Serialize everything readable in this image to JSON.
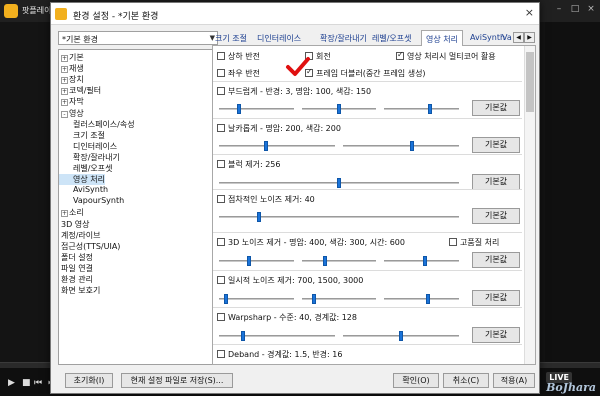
{
  "player": {
    "title": "팟플레이어 -",
    "live_label": "LIVE",
    "watermark": "BoJhara"
  },
  "dialog": {
    "title": "환경 설정 - *기본 환경",
    "close": "×"
  },
  "preset": {
    "value": "*기본 환경",
    "arrow": "▼"
  },
  "tree": [
    {
      "label": "기본",
      "exp": "+",
      "indent": 0
    },
    {
      "label": "재생",
      "exp": "+",
      "indent": 0
    },
    {
      "label": "장치",
      "exp": "+",
      "indent": 0
    },
    {
      "label": "코덱/필터",
      "exp": "+",
      "indent": 0
    },
    {
      "label": "자막",
      "exp": "+",
      "indent": 0
    },
    {
      "label": "영상",
      "exp": "-",
      "indent": 0
    },
    {
      "label": "컬러스페이스/속성",
      "exp": "",
      "indent": 1
    },
    {
      "label": "크기 조절",
      "exp": "",
      "indent": 1
    },
    {
      "label": "디인터레이스",
      "exp": "",
      "indent": 1
    },
    {
      "label": "확장/잘라내기",
      "exp": "",
      "indent": 1
    },
    {
      "label": "레벨/오프셋",
      "exp": "",
      "indent": 1
    },
    {
      "label": "영상 처리",
      "exp": "",
      "indent": 1,
      "selected": true
    },
    {
      "label": "AviSynth",
      "exp": "",
      "indent": 1
    },
    {
      "label": "VapourSynth",
      "exp": "",
      "indent": 1
    },
    {
      "label": "소리",
      "exp": "+",
      "indent": 0
    },
    {
      "label": "3D 영상",
      "exp": "",
      "indent": 0
    },
    {
      "label": "계정/라이브",
      "exp": "",
      "indent": 0
    },
    {
      "label": "접근성(TTS/UIA)",
      "exp": "",
      "indent": 0
    },
    {
      "label": "폴더 설정",
      "exp": "",
      "indent": 0
    },
    {
      "label": "파일 연결",
      "exp": "",
      "indent": 0
    },
    {
      "label": "환경 관리",
      "exp": "",
      "indent": 0
    },
    {
      "label": "화면 보호기",
      "exp": "",
      "indent": 0
    }
  ],
  "tabs": [
    "크기 조절",
    "디인터레이스",
    "확장/잘라내기",
    "레벨/오프셋",
    "영상 처리",
    "AviSynth",
    "Va"
  ],
  "tab_scroll": {
    "left": "◀",
    "right": "▶"
  },
  "checks": {
    "hflip": "상하 반전",
    "rotate": "회전",
    "multicore": "영상 처리시 멀티코어 활용",
    "vflip": "좌우 반전",
    "frame_double": "프레임 더블러(중간 프레임 생성)"
  },
  "sections": [
    {
      "label": "부드럽게 - 반경: 3, 명암: 100, 색감: 150",
      "button": "기본값",
      "slider_values": [
        0.25,
        0.5,
        0.62
      ]
    },
    {
      "label": "날카롭게 - 명암: 200, 색감: 200",
      "button": "기본값",
      "slider_values": [
        0.4,
        0.6
      ]
    },
    {
      "label": "블럭 제거: 256",
      "button": "기본값",
      "slider_values": [
        0.5
      ]
    },
    {
      "label": "점차적인 노이즈 제거: 40",
      "button": "기본값",
      "slider_values": [
        0.16
      ]
    },
    {
      "label": "3D 노이즈 제거 - 명암: 400, 색감: 300, 시간: 600",
      "button": "기본값",
      "extra_check": "고품질 처리",
      "slider_values": [
        0.4,
        0.3,
        0.55
      ]
    },
    {
      "label": "일시적 노이즈 제거: 700, 1500, 3000",
      "button": "기본값",
      "slider_values": [
        0.07,
        0.15,
        0.59
      ]
    },
    {
      "label": "Warpsharp - 수준: 40, 경계값: 128",
      "button": "기본값",
      "slider_values": [
        0.2,
        0.5
      ]
    },
    {
      "label": "Deband - 경계값: 1.5, 반경: 16",
      "button": "",
      "slider_values": []
    }
  ],
  "footer": {
    "reset": "초기화(I)",
    "save_as": "현재 설정 파일로 저장(S)...",
    "ok": "확인(O)",
    "cancel": "취소(C)",
    "apply": "적용(A)"
  }
}
